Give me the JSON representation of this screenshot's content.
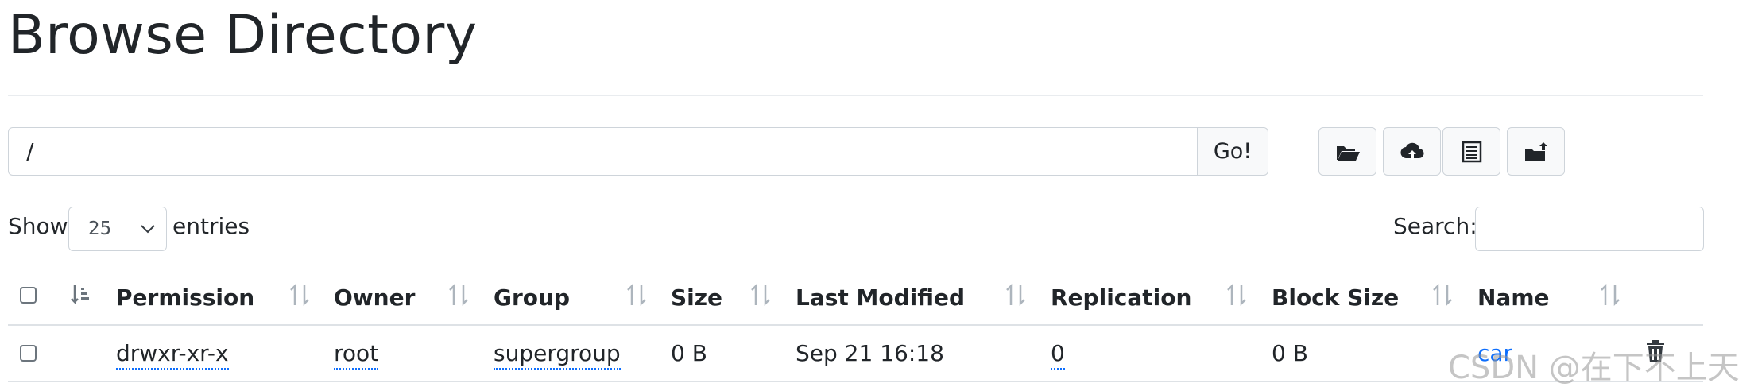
{
  "header": {
    "title": "Browse Directory"
  },
  "path_bar": {
    "value": "/",
    "go_label": "Go!"
  },
  "toolbar": {
    "buttons": [
      {
        "icon": "folder-open-icon"
      },
      {
        "icon": "cloud-upload-icon"
      },
      {
        "icon": "list-alt-icon"
      },
      {
        "icon": "folder-move-icon"
      }
    ]
  },
  "table_controls": {
    "show_label": "Show",
    "entries_value": "25",
    "entries_label": "entries",
    "search_label": "Search:",
    "search_value": ""
  },
  "table": {
    "columns": [
      "Permission",
      "Owner",
      "Group",
      "Size",
      "Last Modified",
      "Replication",
      "Block Size",
      "Name"
    ],
    "rows": [
      {
        "permission": "drwxr-xr-x",
        "owner": "root",
        "group": "supergroup",
        "size": "0 B",
        "last_modified": "Sep 21 16:18",
        "replication": "0",
        "block_size": "0 B",
        "name": "car"
      }
    ]
  },
  "watermark": "CSDN @在下不上天",
  "colors": {
    "link": "#0d6efd",
    "border": "#ced4da",
    "text": "#212529"
  }
}
